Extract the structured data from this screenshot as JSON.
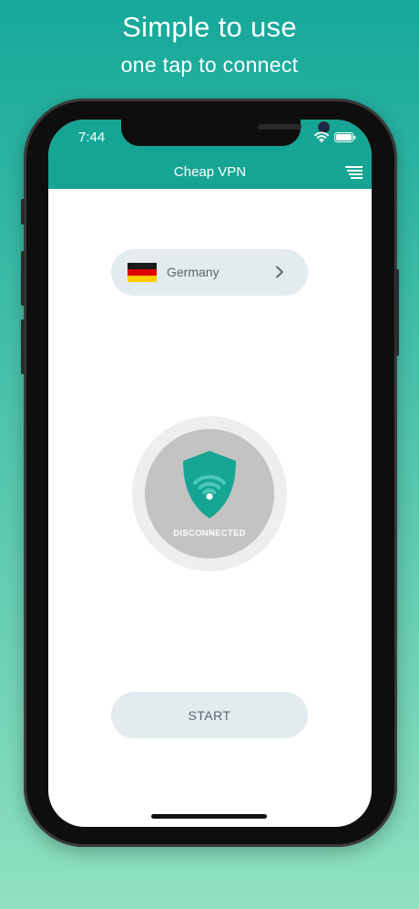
{
  "promo": {
    "title": "Simple to use",
    "subtitle": "one tap to connect"
  },
  "status_bar": {
    "time": "7:44",
    "icons": [
      "wifi-icon",
      "battery-icon"
    ]
  },
  "app": {
    "title": "Cheap VPN",
    "menu_icon": "menu-icon"
  },
  "server": {
    "country": "Germany",
    "flag_icon": "germany-flag-icon",
    "flag_colors": [
      "#1a1a1a",
      "#dd0000",
      "#ffce00"
    ]
  },
  "connection": {
    "status": "DISCONNECTED",
    "icon": "shield-wifi-icon"
  },
  "actions": {
    "start_label": "START"
  },
  "colors": {
    "accent": "#16a594",
    "status_gray": "#c3c3c3",
    "pill_bg": "#e3ebee"
  }
}
